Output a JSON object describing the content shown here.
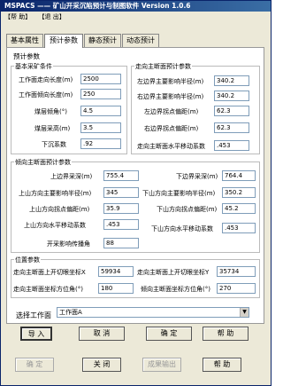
{
  "window": {
    "title": "MSPACS —— 矿山开采沉陷预计与制图软件 Version 1.0.6"
  },
  "menu": {
    "help": "【帮 助】",
    "exit": "【退 出】"
  },
  "tabs": [
    "基本属性",
    "预计参数",
    "静态预计",
    "动态预计"
  ],
  "params": {
    "title": "预计参数",
    "basic": {
      "title": "基本采矿条件",
      "strike_length_label": "工作面走向长度(m)",
      "strike_length": "2500",
      "dip_length_label": "工作面倾向长度(m)",
      "dip_length": "250",
      "seam_dip_label": "煤层倾角(°)",
      "seam_dip": "4.5",
      "thickness_label": "煤层采高(m)",
      "thickness": "3.5",
      "subsidence_coef_label": "下沉系数",
      "subsidence_coef": ".92"
    },
    "strike_main": {
      "title": "走向主断面预计参数",
      "left_radius_label": "左边界主要影响半径(m)",
      "left_radius": "340.2",
      "right_radius_label": "右边界主要影响半径(m)",
      "right_radius": "340.2",
      "left_offset_label": "左边界拐点偏距(m)",
      "left_offset": "62.3",
      "right_offset_label": "右边界拐点偏距(m)",
      "right_offset": "62.3",
      "horizontal_coef_label": "走向主断面水平移动系数",
      "horizontal_coef": ".453"
    },
    "dip_main": {
      "title": "倾向主断面预计参数",
      "up_depth_label": "上边界采深(m)",
      "up_depth": "755.4",
      "down_depth_label": "下边界采深(m)",
      "down_depth": "764.4",
      "up_radius_label": "上山方向主要影响半径(m)",
      "up_radius": "345",
      "down_radius_label": "下山方向主要影响半径(m)",
      "down_radius": "350.2",
      "up_offset_label": "上山方向拐点偏距(m)",
      "up_offset": "35.9",
      "down_offset_label": "下山方向拐点偏距(m)",
      "down_offset": "45.2",
      "up_horiz_label": "上山方向水平移动系数",
      "up_horiz": ".453",
      "down_horiz_label": "下山方向水平移动系数",
      "down_horiz": ".453",
      "influence_angle_label": "开采影响传播角",
      "influence_angle": "88"
    },
    "position": {
      "title": "位置参数",
      "strike_up_x_label": "走向主断面上开切眼坐标X",
      "strike_up_x": "59934",
      "strike_up_y_label": "走向主断面上开切眼坐标Y",
      "strike_up_y": "35734",
      "strike_azimuth_label": "走向主断面坐标方位角(°)",
      "strike_azimuth": "180",
      "dip_azimuth_label": "倾向主断面坐标方位角(°)",
      "dip_azimuth": "270"
    },
    "select_face_label": "选择工作面",
    "select_face_value": "工作面A"
  },
  "panel_buttons": {
    "import": "导 入",
    "cancel": "取 消",
    "ok": "确 定",
    "help": "帮 助"
  },
  "bottom_buttons": {
    "confirm": "确 定",
    "close": "关 闭",
    "export": "成果输出",
    "help": "帮 助"
  }
}
